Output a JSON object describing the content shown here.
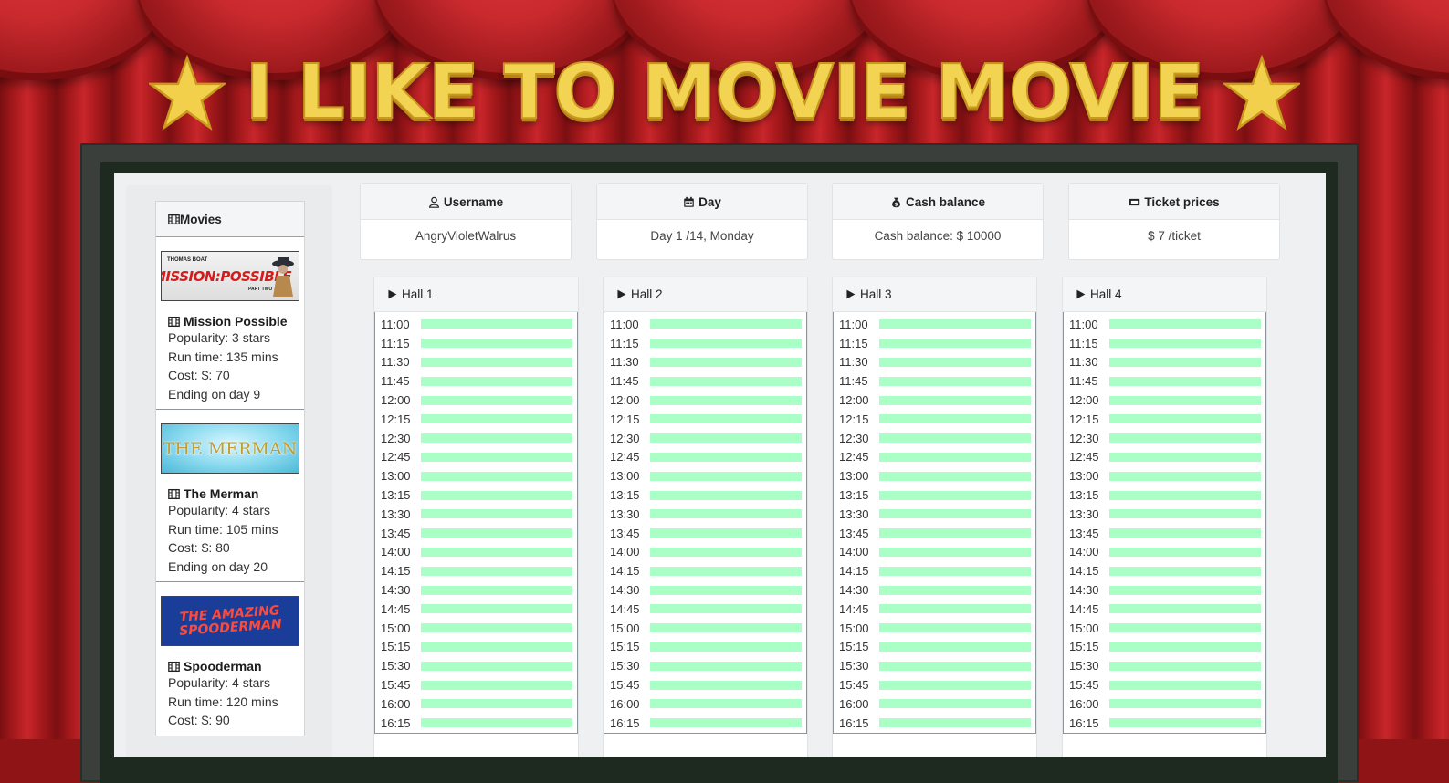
{
  "game_title": "I LIKE TO MOVIE MOVIE",
  "colors": {
    "curtain": "#c8262a",
    "title_gold": "#f3d452",
    "slot_free": "#aaffc6"
  },
  "movies_panel": {
    "header": "Movies",
    "header_icon": "film-icon",
    "items": [
      {
        "poster_text": "MISSION:POSSIBLE",
        "poster_top": "THOMAS BOAT",
        "poster_bottom": "PART TWO",
        "title": "Mission Possible",
        "popularity": "Popularity: 3 stars",
        "run_time": "Run time: 135 mins",
        "cost": "Cost: $: 70",
        "ending": "Ending on day 9"
      },
      {
        "poster_text": "THE MERMAN",
        "title": "The Merman",
        "popularity": "Popularity: 4 stars",
        "run_time": "Run time: 105 mins",
        "cost": "Cost: $: 80",
        "ending": "Ending on day 20"
      },
      {
        "poster_text": "THE AMAZING SPOODERMAN",
        "title": "Spooderman",
        "popularity": "Popularity: 4 stars",
        "run_time": "Run time: 120 mins",
        "cost": "Cost: $: 90"
      }
    ]
  },
  "info": {
    "username": {
      "label": "Username",
      "value": "AngryVioletWalrus",
      "icon": "user-icon"
    },
    "day": {
      "label": "Day",
      "value": "Day 1 /14, Monday",
      "icon": "calendar-icon"
    },
    "cash": {
      "label": "Cash balance",
      "value": "Cash balance: $ 10000",
      "icon": "money-bag-icon"
    },
    "ticket": {
      "label": "Ticket prices",
      "value": "$ 7 /ticket",
      "icon": "ticket-icon"
    }
  },
  "halls": [
    {
      "label": "Hall 1"
    },
    {
      "label": "Hall 2"
    },
    {
      "label": "Hall 3"
    },
    {
      "label": "Hall 4"
    }
  ],
  "time_slots": [
    "11:00",
    "11:15",
    "11:30",
    "11:45",
    "12:00",
    "12:15",
    "12:30",
    "12:45",
    "13:00",
    "13:15",
    "13:30",
    "13:45",
    "14:00",
    "14:15",
    "14:30",
    "14:45",
    "15:00",
    "15:15",
    "15:30",
    "15:45",
    "16:00",
    "16:15"
  ]
}
